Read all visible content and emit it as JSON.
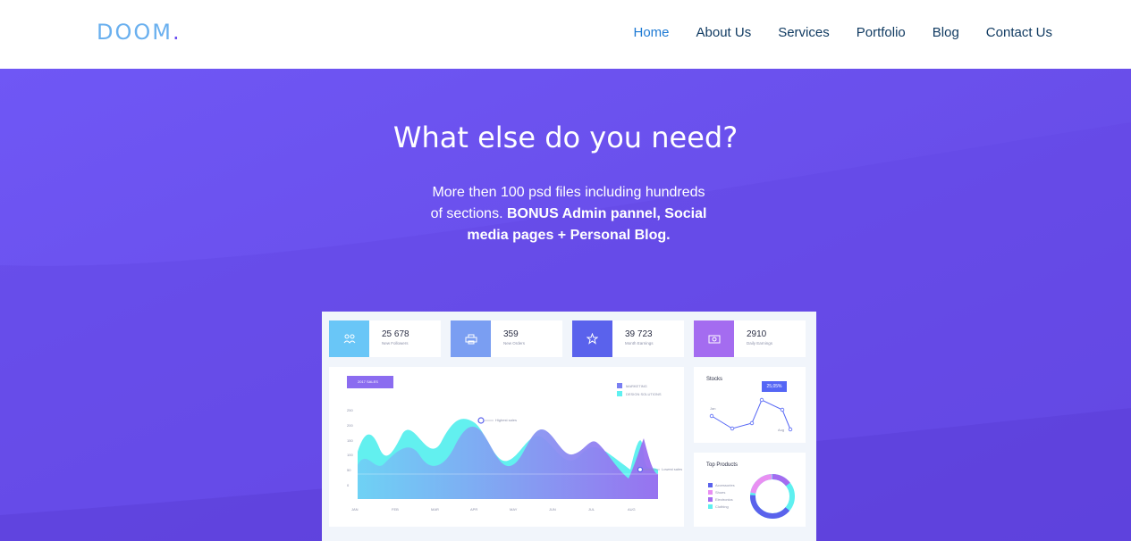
{
  "brand": {
    "logo": "DOOM",
    "logo_dot": "."
  },
  "nav": {
    "items": [
      {
        "label": "Home",
        "active": true
      },
      {
        "label": "About Us",
        "active": false
      },
      {
        "label": "Services",
        "active": false
      },
      {
        "label": "Portfolio",
        "active": false
      },
      {
        "label": "Blog",
        "active": false
      },
      {
        "label": "Contact Us",
        "active": false
      }
    ]
  },
  "hero": {
    "title": "What else do you need?",
    "text_plain": "More then 100 psd files including hundreds of sections. ",
    "text_bold": "BONUS Admin pannel, Social media pages + Personal Blog."
  },
  "dashboard": {
    "stats": [
      {
        "value": "25 678",
        "label": "New Followers",
        "color": "#69c6f7",
        "icon": "users-icon"
      },
      {
        "value": "359",
        "label": "New Orders",
        "color": "#7a9ef2",
        "icon": "printer-icon"
      },
      {
        "value": "39 723",
        "label": "Month Earnings",
        "color": "#5a62ec",
        "icon": "star-icon"
      },
      {
        "value": "2910",
        "label": "Daily Earnings",
        "color": "#a46cf0",
        "icon": "money-icon"
      }
    ],
    "sales_chart": {
      "badge": "2017 SALES",
      "legend": [
        {
          "label": "MARKETING",
          "color": "#7a7ff2"
        },
        {
          "label": "DESIGN SOLUTIONS",
          "color": "#5ff0f0"
        }
      ],
      "y_ticks": [
        "250",
        "200",
        "150",
        "100",
        "50",
        "0"
      ],
      "x_ticks": [
        "JAN",
        "FEB",
        "MAR",
        "APR",
        "MAY",
        "JUN",
        "JUL",
        "AUG"
      ],
      "annotations": {
        "highest": "Highest sales",
        "lowest": "Lowest sales"
      }
    },
    "stocks": {
      "title": "Stocks",
      "badge": "25,05%",
      "start_label": "Jan",
      "end_label": "Aug"
    },
    "top_products": {
      "title": "Top Products",
      "items": [
        {
          "label": "Accessories",
          "color": "#5a62ec"
        },
        {
          "label": "Shoes",
          "color": "#e98ff2"
        },
        {
          "label": "Electronics",
          "color": "#a46cf0"
        },
        {
          "label": "Clothing",
          "color": "#5ff0f0"
        }
      ]
    }
  }
}
